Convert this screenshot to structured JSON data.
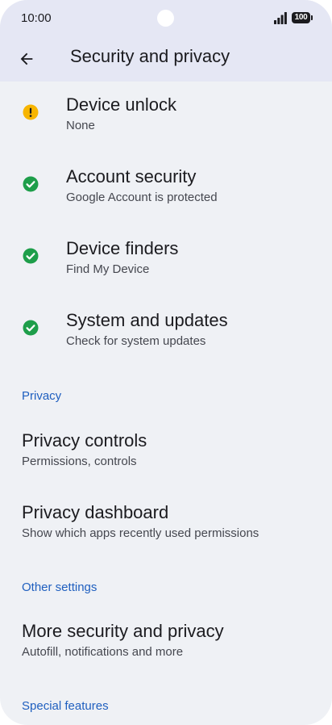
{
  "status_bar": {
    "time": "10:00",
    "battery": "100",
    "icons": [
      "signal-icon",
      "battery-icon"
    ]
  },
  "header": {
    "title": "Security and privacy",
    "back_icon": "arrow-back-icon"
  },
  "status_items": [
    {
      "title": "Device unlock",
      "subtitle": "None",
      "status": "warning",
      "icon": "warning-icon"
    },
    {
      "title": "Account security",
      "subtitle": "Google Account is protected",
      "status": "ok",
      "icon": "check-circle-icon"
    },
    {
      "title": "Device finders",
      "subtitle": "Find My Device",
      "status": "ok",
      "icon": "check-circle-icon"
    },
    {
      "title": "System and updates",
      "subtitle": "Check for system updates",
      "status": "ok",
      "icon": "check-circle-icon"
    }
  ],
  "privacy_section": {
    "header": "Privacy",
    "items": [
      {
        "title": "Privacy controls",
        "subtitle": "Permissions, controls"
      },
      {
        "title": "Privacy dashboard",
        "subtitle": "Show which apps recently used permissions"
      }
    ]
  },
  "other_section": {
    "header": "Other settings",
    "items": [
      {
        "title": "More security and privacy",
        "subtitle": "Autofill, notifications and more"
      }
    ]
  },
  "special_section": {
    "header": "Special features"
  },
  "colors": {
    "background": "#eff1f5",
    "app_bar": "#e5e7f4",
    "accent": "#1f5fbf",
    "warning": "#f7b500",
    "ok": "#1e9e4a",
    "text_primary": "#1b1b1f",
    "text_secondary": "#45474f"
  }
}
